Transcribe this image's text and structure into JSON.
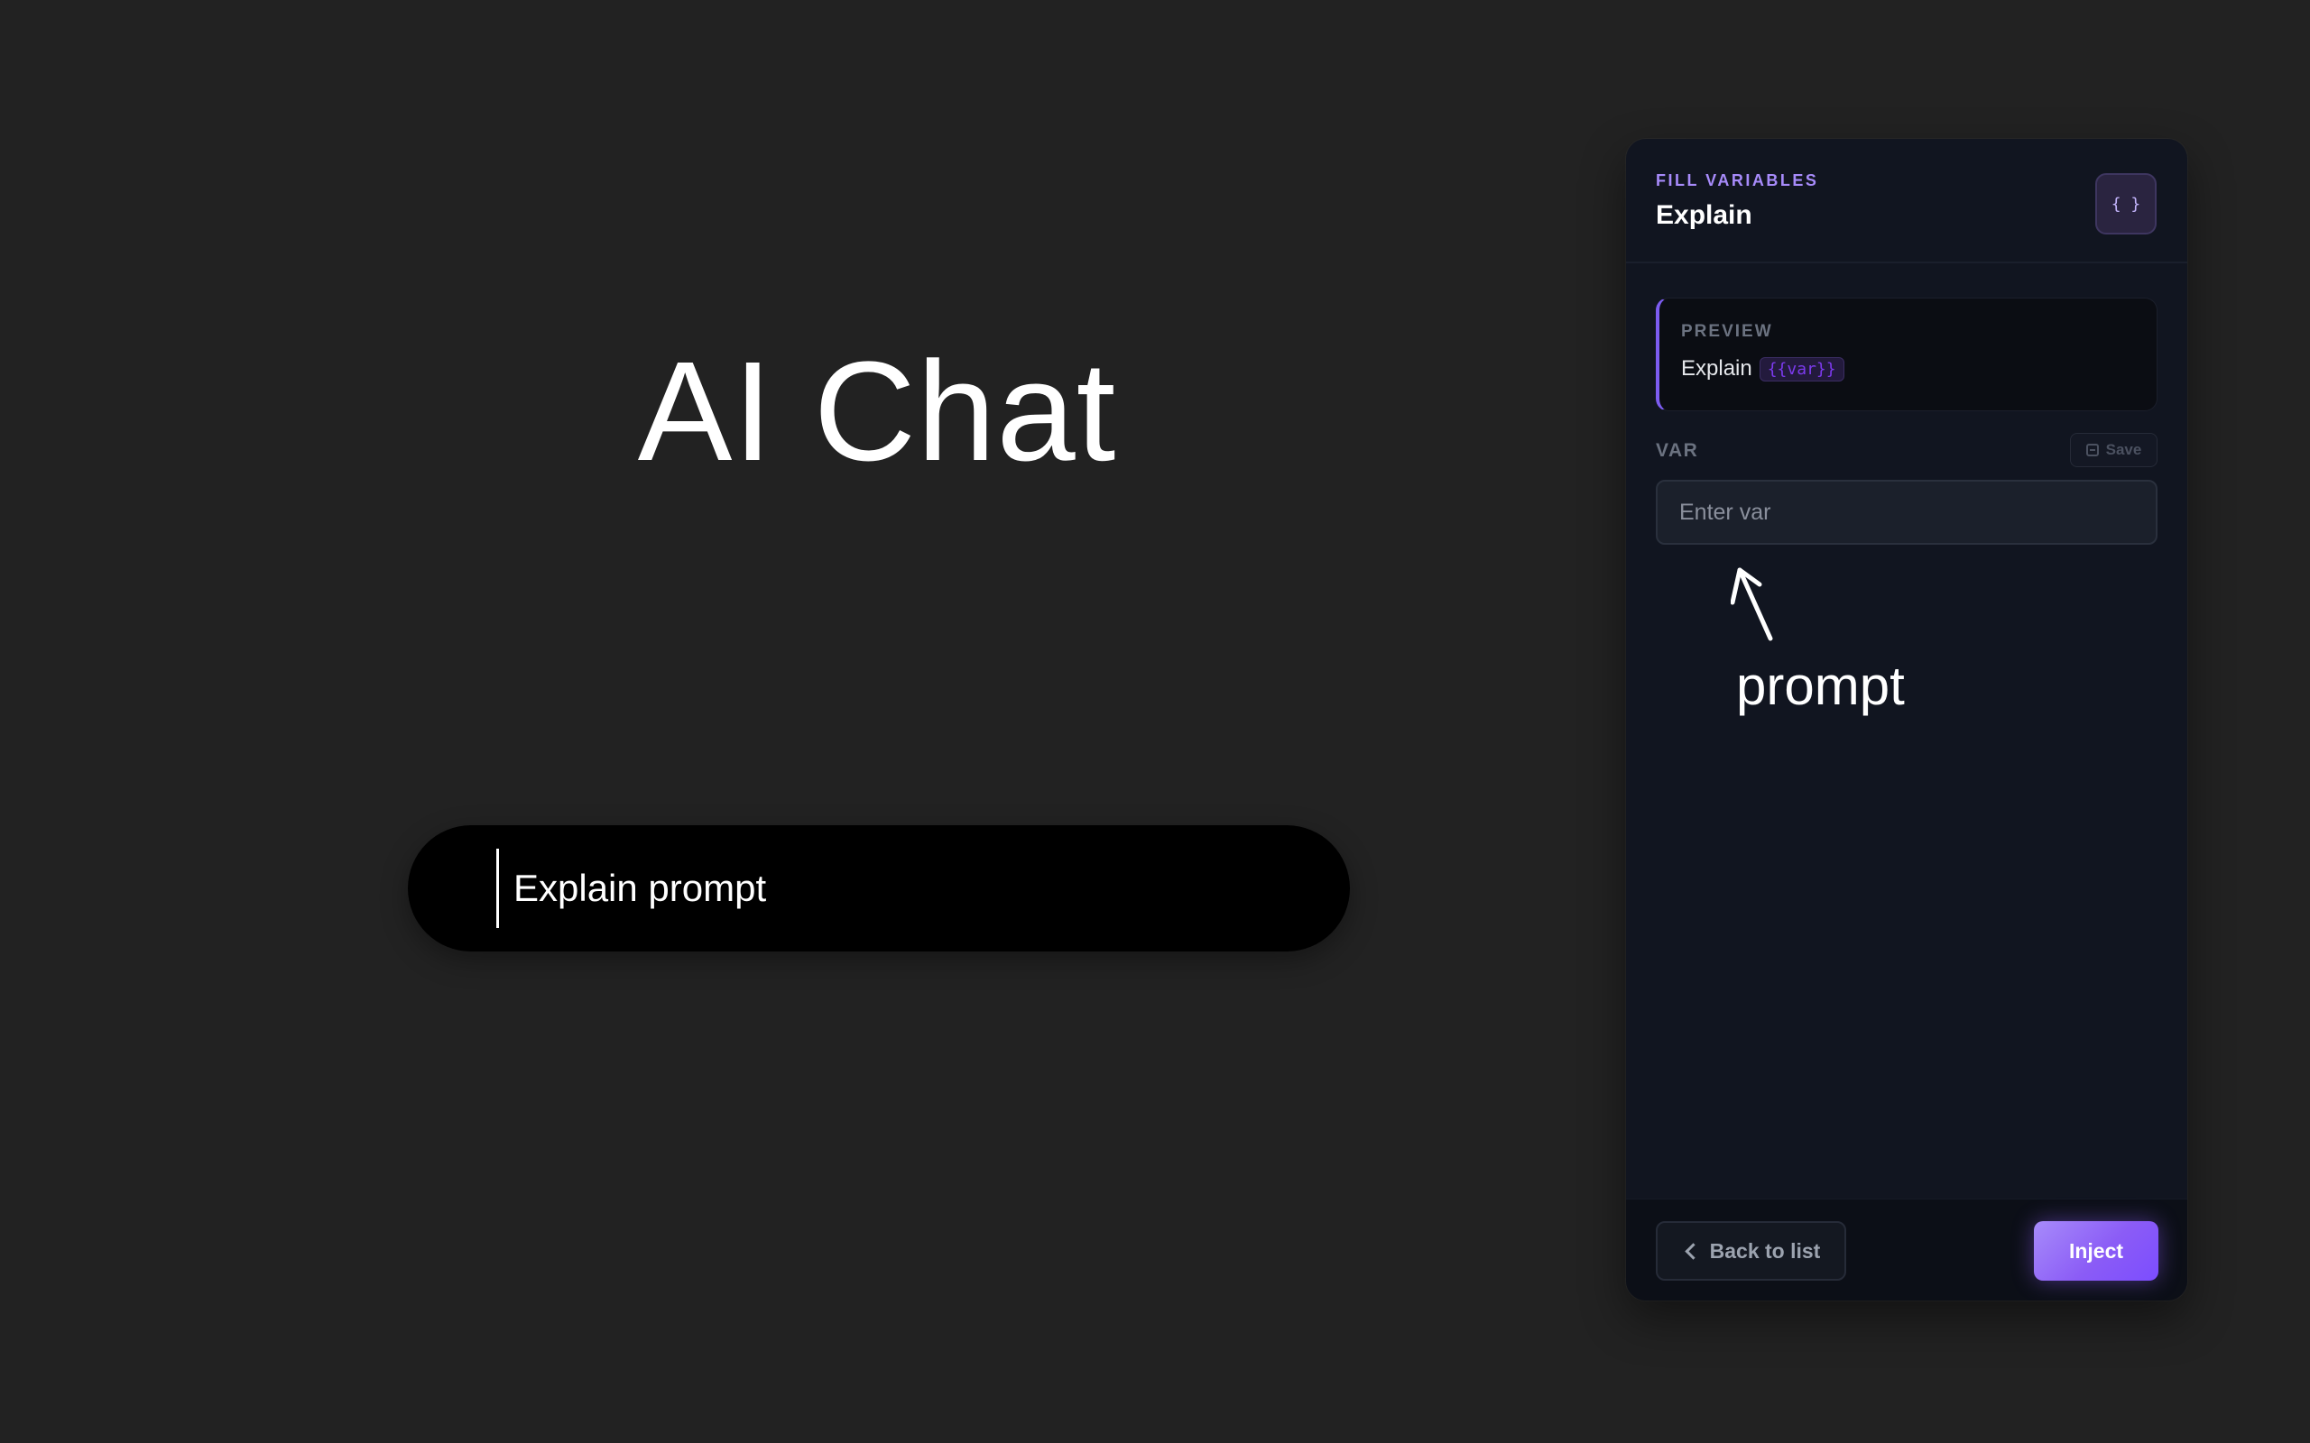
{
  "chat": {
    "title": "AI Chat",
    "input_text": "Explain prompt"
  },
  "panel": {
    "kicker": "FILL VARIABLES",
    "title": "Explain",
    "braces_icon": "{ }",
    "preview": {
      "label": "PREVIEW",
      "text": "Explain",
      "variable_chip": "{{var}}"
    },
    "variable": {
      "label": "VAR",
      "save_label": "Save",
      "placeholder": "Enter var"
    },
    "footer": {
      "back_label": "Back to list",
      "inject_label": "Inject"
    }
  },
  "annotation": {
    "text": "prompt"
  },
  "colors": {
    "background": "#222222",
    "panel": "#111520",
    "accent": "#8b5cf6",
    "kicker": "#a78bfa"
  },
  "icons": {
    "braces": "braces-icon",
    "save": "save-icon",
    "back": "chevron-left-icon",
    "annotation_arrow": "arrow-up-icon"
  }
}
